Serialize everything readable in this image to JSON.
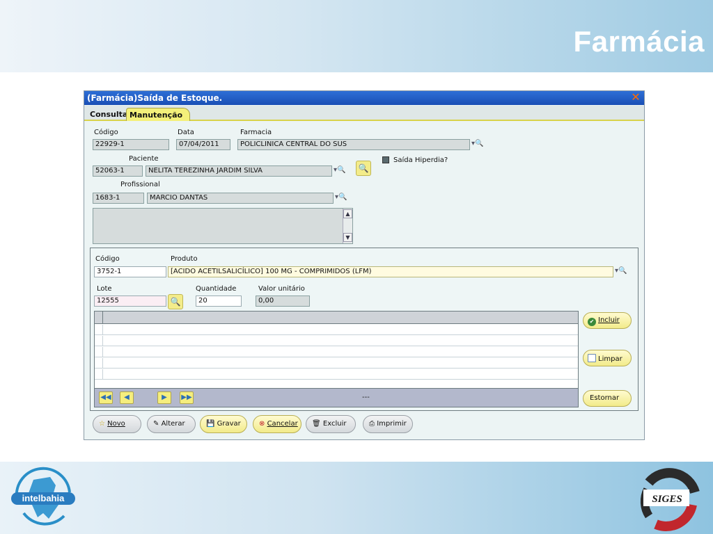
{
  "slide": {
    "title": "Farmácia"
  },
  "logos": {
    "left_text": "intelbahia",
    "right_text": "SIGES"
  },
  "window": {
    "title": "(Farmácia)Saída de Estoque.",
    "tabs": [
      {
        "label": "Consulta"
      },
      {
        "label": "Manutenção"
      }
    ]
  },
  "form": {
    "codigo_label": "Código",
    "codigo_value": "22929-1",
    "data_label": "Data",
    "data_value": "07/04/2011",
    "farmacia_label": "Farmacia",
    "farmacia_value": "POLICLINICA CENTRAL DO SUS",
    "paciente_label": "Paciente",
    "paciente_code": "52063-1",
    "paciente_name": "NELITA TEREZINHA JARDIM SILVA",
    "saida_hiperdia_label": "Saída Hiperdia?",
    "profissional_label": "Profissional",
    "profissional_code": "1683-1",
    "profissional_name": "MARCIO DANTAS"
  },
  "item": {
    "codigo_label": "Código",
    "codigo_value": "3752-1",
    "produto_label": "Produto",
    "produto_value": "[ACIDO ACETILSALICÍLICO] 100 MG - COMPRIMIDOS (LFM)",
    "lote_label": "Lote",
    "lote_value": "12555",
    "quantidade_label": "Quantidade",
    "quantidade_value": "20",
    "valor_label": "Valor unitário",
    "valor_value": "0,00"
  },
  "grid": {
    "status": "---"
  },
  "side_buttons": {
    "incluir": "Incluir",
    "limpar": "Limpar",
    "estornar": "Estornar"
  },
  "bottom_buttons": {
    "novo": "Novo",
    "alterar": "Alterar",
    "gravar": "Gravar",
    "cancelar": "Cancelar",
    "excluir": "Excluir",
    "imprimir": "Imprimir"
  },
  "colors": {
    "titlebar": "#1a4fb5",
    "accent_yellow": "#f4f07a",
    "band_blue": "#9fcbe3"
  }
}
